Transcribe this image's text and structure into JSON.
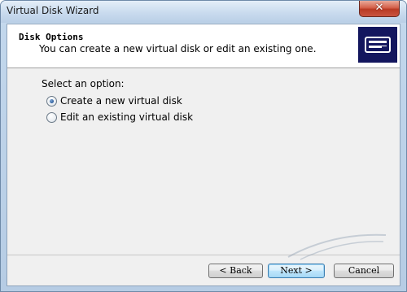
{
  "window": {
    "title": "Virtual Disk Wizard",
    "close_glyph": "✕"
  },
  "header": {
    "title": "Disk Options",
    "subtitle": "You can create a new virtual disk or edit an existing one.",
    "icon": "disk-drive-icon"
  },
  "body": {
    "prompt": "Select an option:",
    "options": [
      {
        "label": "Create a new virtual disk",
        "selected": true
      },
      {
        "label": "Edit an existing virtual disk",
        "selected": false
      }
    ]
  },
  "buttons": {
    "back": "< Back",
    "next": "Next >",
    "cancel": "Cancel"
  },
  "colors": {
    "header_icon_bg": "#13165e",
    "close_button": "#c85440",
    "default_button": "#bee6fd"
  }
}
